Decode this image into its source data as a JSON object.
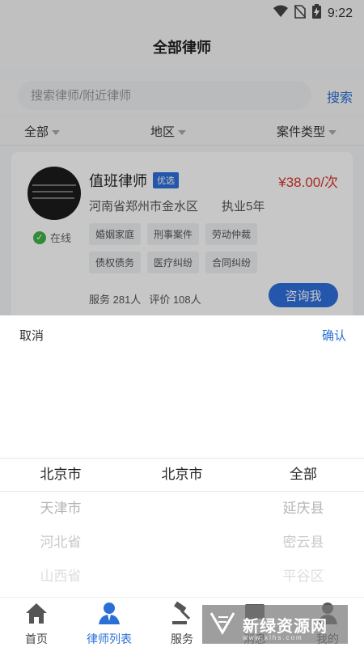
{
  "status_bar": {
    "time": "9:22",
    "icons": [
      "wifi-icon",
      "no-sim-icon",
      "battery-charging-icon"
    ]
  },
  "header": {
    "title": "全部律师"
  },
  "search": {
    "placeholder": "搜索律师/附近律师",
    "button_label": "搜索"
  },
  "filters": [
    {
      "label": "全部"
    },
    {
      "label": "地区"
    },
    {
      "label": "案件类型"
    }
  ],
  "lawyer_card": {
    "name": "值班律师",
    "badge": "优选",
    "price": "¥38.00/次",
    "location": "河南省郑州市金水区",
    "experience": "执业5年",
    "status": "在线",
    "tags": [
      "婚姻家庭",
      "刑事案件",
      "劳动仲裁",
      "债权债务",
      "医疗纠纷",
      "合同纠纷"
    ],
    "service_count": "服务 281人",
    "review_count": "评价 108人",
    "consult_label": "咨询我"
  },
  "picker_sheet": {
    "cancel_label": "取消",
    "confirm_label": "确认",
    "columns": [
      {
        "options": [
          "北京市",
          "天津市",
          "河北省",
          "山西省"
        ]
      },
      {
        "options": [
          "北京市",
          "",
          "",
          ""
        ]
      },
      {
        "options": [
          "全部",
          "延庆县",
          "密云县",
          "平谷区"
        ]
      }
    ]
  },
  "tab_bar": {
    "items": [
      {
        "label": "首页",
        "icon": "home-icon"
      },
      {
        "label": "律师列表",
        "icon": "lawyer-icon",
        "active": true
      },
      {
        "label": "服务",
        "icon": "gavel-icon"
      },
      {
        "label": "消息",
        "icon": "message-icon"
      },
      {
        "label": "我的",
        "icon": "profile-icon"
      }
    ]
  },
  "watermark": {
    "text": "新绿资源网",
    "sub": "www.xlhs.com"
  },
  "colors": {
    "accent": "#2f6fdc",
    "price": "#d9362b",
    "online": "#3fb24c"
  }
}
